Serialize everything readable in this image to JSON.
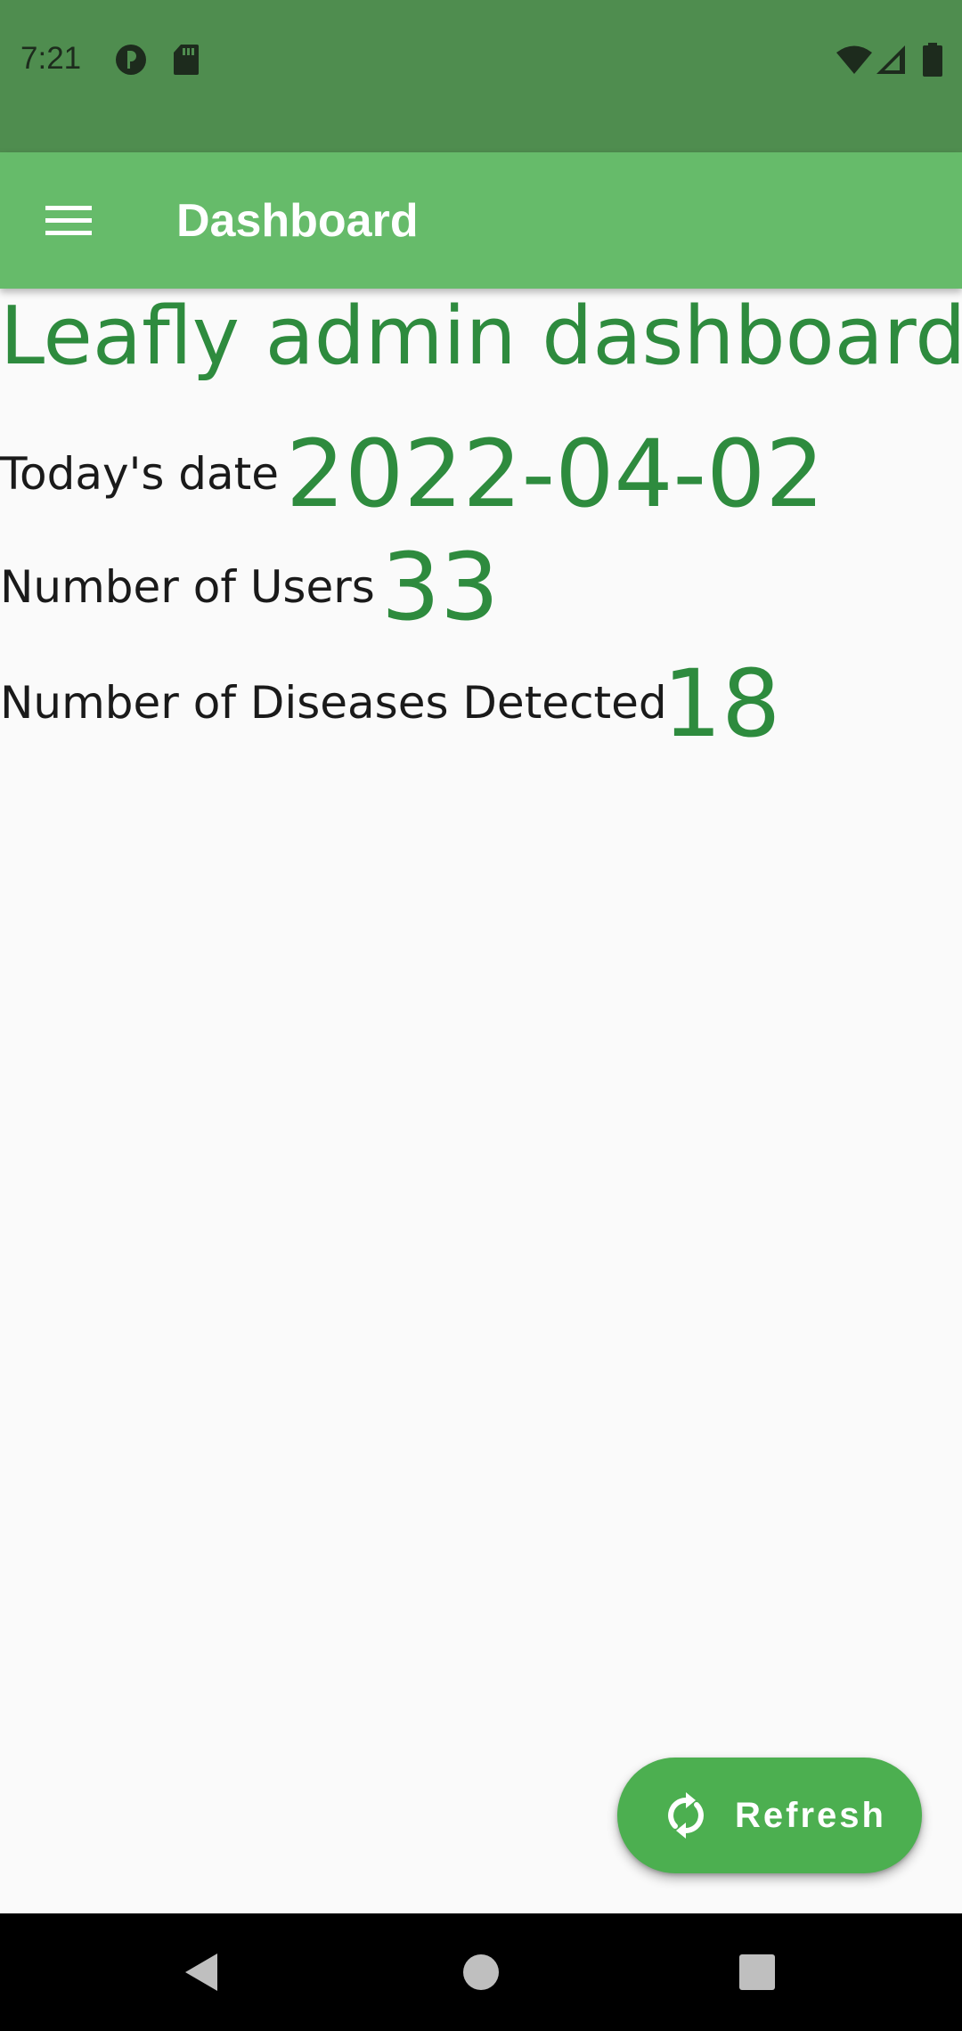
{
  "status_bar": {
    "time": "7:21",
    "left_icons": [
      "privacy-indicator-icon",
      "sd-card-icon"
    ],
    "right_icons": [
      "wifi-icon",
      "cellular-signal-icon",
      "battery-icon"
    ],
    "background": "#4f8d4f"
  },
  "app_bar": {
    "menu_icon": "hamburger-menu-icon",
    "title": "Dashboard",
    "background": "#66bb6a"
  },
  "main": {
    "heading": "Leafly admin dashboard",
    "stats": [
      {
        "label": "Today's date",
        "value": "2022-04-02"
      },
      {
        "label": "Number of Users",
        "value": "33"
      },
      {
        "label": "Number of Diseases Detected",
        "value": "18"
      }
    ],
    "accent_color": "#2e8b3e"
  },
  "fab": {
    "icon": "refresh-icon",
    "label": "Refresh",
    "background": "#4caf50"
  },
  "nav_bar": {
    "buttons": [
      "back-icon",
      "home-icon",
      "recents-icon"
    ]
  }
}
